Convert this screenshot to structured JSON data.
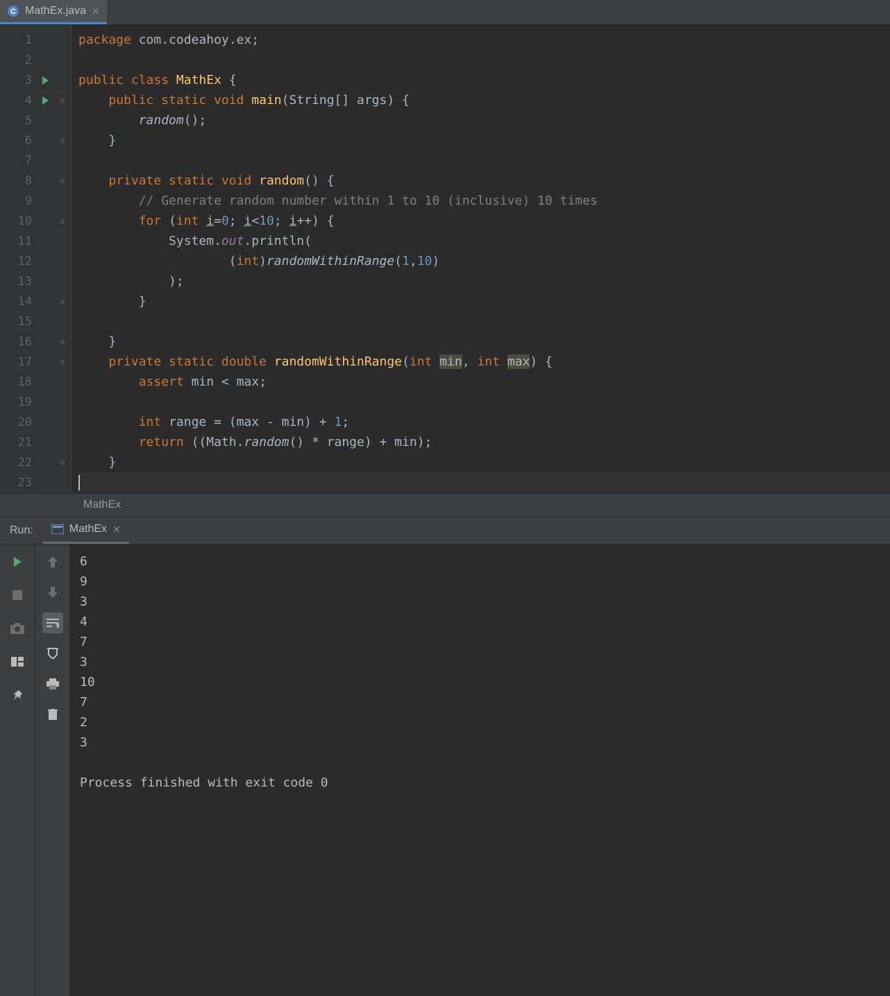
{
  "tab": {
    "filename": "MathEx.java"
  },
  "editor": {
    "breadcrumb": "MathEx",
    "lines": [
      {
        "n": 1,
        "html": "<span class='kw'>package</span> com.codeahoy.ex;"
      },
      {
        "n": 2,
        "html": ""
      },
      {
        "n": 3,
        "run": true,
        "html": "<span class='kw'>public class</span> <span class='fn'>MathEx</span> {"
      },
      {
        "n": 4,
        "run": true,
        "fold": "-",
        "html": "    <span class='kw'>public static void</span> <span class='fn'>main</span>(String[] args) {"
      },
      {
        "n": 5,
        "html": "        <span class='italic'>random</span>();"
      },
      {
        "n": 6,
        "fold": "-",
        "html": "    }"
      },
      {
        "n": 7,
        "html": ""
      },
      {
        "n": 8,
        "fold": "-",
        "html": "    <span class='kw'>private static void</span> <span class='fn'>random</span>() {"
      },
      {
        "n": 9,
        "html": "        <span class='comment'>// Generate random number within 1 to 10 (inclusive) 10 times</span>"
      },
      {
        "n": 10,
        "fold": "-",
        "html": "        <span class='kw'>for</span> (<span class='kw'>int</span> <u>i</u>=<span class='num'>0</span>; <u>i</u>&lt;<span class='num'>10</span>; <u>i</u>++) {"
      },
      {
        "n": 11,
        "html": "            System.<span class='field-italic'>out</span>.println("
      },
      {
        "n": 12,
        "html": "                    (<span class='kw'>int</span>)<span class='italic'>randomWithinRange</span>(<span class='num'>1</span>,<span class='num'>10</span>)"
      },
      {
        "n": 13,
        "html": "            );"
      },
      {
        "n": 14,
        "fold": "-",
        "html": "        }"
      },
      {
        "n": 15,
        "html": ""
      },
      {
        "n": 16,
        "fold": "-",
        "html": "    }"
      },
      {
        "n": 17,
        "fold": "-",
        "html": "    <span class='kw'>private static double</span> <span class='fn'>randomWithinRange</span>(<span class='kw'>int</span> <span class='hl'>min</span>, <span class='kw'>int</span> <span class='hl'>max</span>) {"
      },
      {
        "n": 18,
        "html": "        <span class='kw'>assert</span> min &lt; max;"
      },
      {
        "n": 19,
        "html": ""
      },
      {
        "n": 20,
        "html": "        <span class='kw'>int</span> range = (max - min) + <span class='num'>1</span>;"
      },
      {
        "n": 21,
        "html": "        <span class='kw'>return</span> ((Math.<span class='italic'>random</span>() * range) + min);"
      },
      {
        "n": 22,
        "fold": "-",
        "html": "    }"
      },
      {
        "n": 23,
        "current": true,
        "html": "<span class='caret'></span>"
      }
    ]
  },
  "run": {
    "label": "Run:",
    "config_name": "MathEx",
    "output": [
      "6",
      "9",
      "3",
      "4",
      "7",
      "3",
      "10",
      "7",
      "2",
      "3",
      "",
      "Process finished with exit code 0",
      ""
    ]
  }
}
